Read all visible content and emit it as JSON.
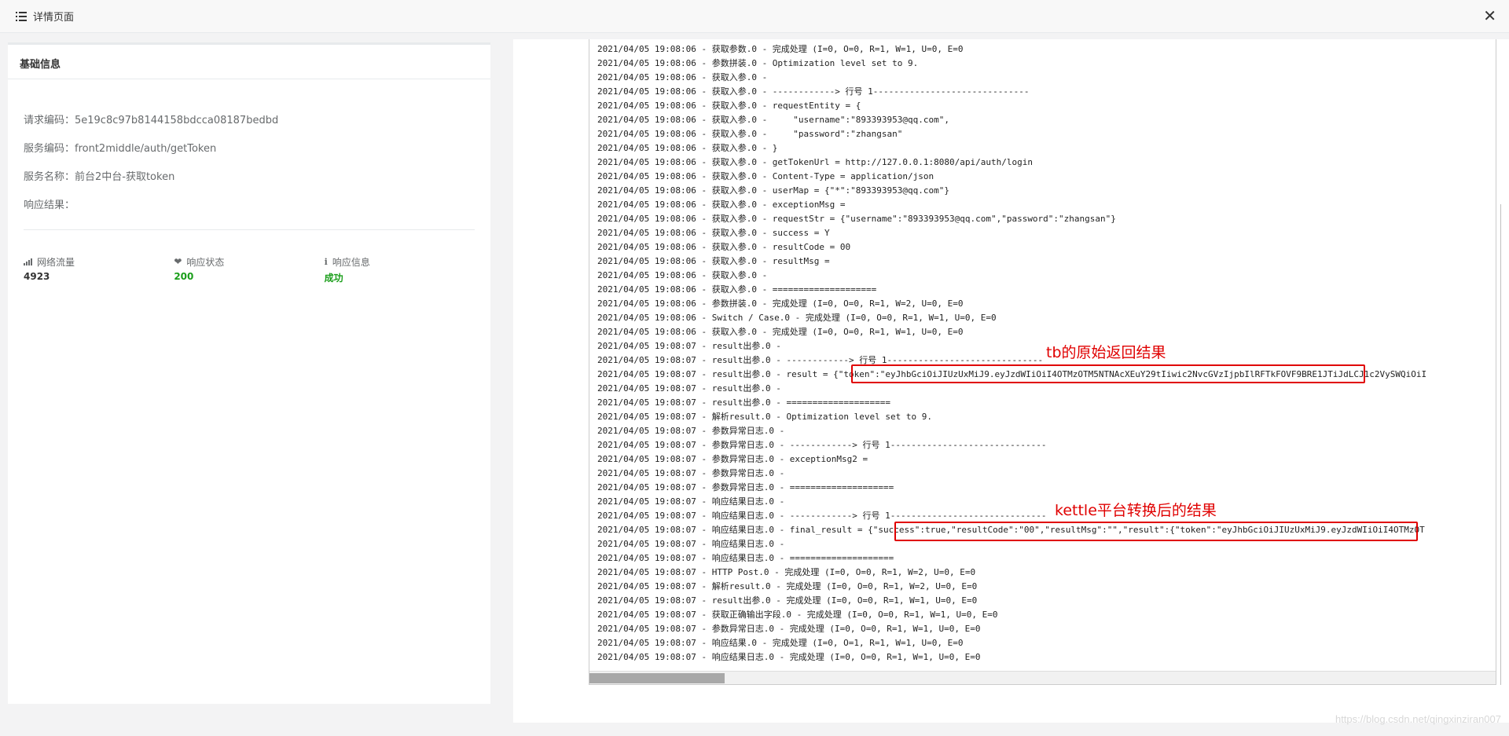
{
  "window": {
    "title": "详情页面",
    "close_symbol": "✕"
  },
  "basic_info": {
    "panel_title": "基础信息",
    "fields": [
      {
        "text": "请求编码：5e19c8c97b8144158bdcca08187bedbd"
      },
      {
        "text": "服务编码：front2middle/auth/getToken"
      },
      {
        "text": "服务名称：前台2中台-获取token"
      },
      {
        "text": "响应结果："
      }
    ],
    "stats": [
      {
        "label": "网络流量",
        "value": "4923",
        "icon": "signal-icon",
        "color": "#333333"
      },
      {
        "label": "响应状态",
        "value": "200",
        "icon": "heartbeat-icon",
        "color": "#1ab394"
      },
      {
        "label": "响应信息",
        "value": "成功",
        "icon": "info-icon",
        "color": "#1ab394"
      }
    ]
  },
  "log_lines": [
    "2021/04/05 19:08:06 - 获取参数.0 - 完成处理 (I=0, O=0, R=1, W=1, U=0, E=0",
    "2021/04/05 19:08:06 - 参数拼装.0 - Optimization level set to 9.",
    "2021/04/05 19:08:06 - 获取入参.0 -",
    "2021/04/05 19:08:06 - 获取入参.0 - ------------> 行号 1------------------------------",
    "2021/04/05 19:08:06 - 获取入参.0 - requestEntity = {",
    "2021/04/05 19:08:06 - 获取入参.0 -     \"username\":\"893393953@qq.com\",",
    "2021/04/05 19:08:06 - 获取入参.0 -     \"password\":\"zhangsan\"",
    "2021/04/05 19:08:06 - 获取入参.0 - }",
    "2021/04/05 19:08:06 - 获取入参.0 - getTokenUrl = http://127.0.0.1:8080/api/auth/login",
    "2021/04/05 19:08:06 - 获取入参.0 - Content-Type = application/json",
    "2021/04/05 19:08:06 - 获取入参.0 - userMap = {\"*\":\"893393953@qq.com\"}",
    "2021/04/05 19:08:06 - 获取入参.0 - exceptionMsg =",
    "2021/04/05 19:08:06 - 获取入参.0 - requestStr = {\"username\":\"893393953@qq.com\",\"password\":\"zhangsan\"}",
    "2021/04/05 19:08:06 - 获取入参.0 - success = Y",
    "2021/04/05 19:08:06 - 获取入参.0 - resultCode = 00",
    "2021/04/05 19:08:06 - 获取入参.0 - resultMsg =",
    "2021/04/05 19:08:06 - 获取入参.0 -",
    "2021/04/05 19:08:06 - 获取入参.0 - ====================",
    "2021/04/05 19:08:06 - 参数拼装.0 - 完成处理 (I=0, O=0, R=1, W=2, U=0, E=0",
    "2021/04/05 19:08:06 - Switch / Case.0 - 完成处理 (I=0, O=0, R=1, W=1, U=0, E=0",
    "2021/04/05 19:08:06 - 获取入参.0 - 完成处理 (I=0, O=0, R=1, W=1, U=0, E=0",
    "2021/04/05 19:08:07 - result出参.0 -",
    "2021/04/05 19:08:07 - result出参.0 - ------------> 行号 1------------------------------",
    "2021/04/05 19:08:07 - result出参.0 - result = {\"token\":\"eyJhbGciOiJIUzUxMiJ9.eyJzdWIiOiI4OTMzOTM5NTNAcXEuY29tIiwic2NvcGVzIjpbIlRFTkFOVF9BRE1JTiJdLCJ1c2VySWQiOiI",
    "2021/04/05 19:08:07 - result出参.0 -",
    "2021/04/05 19:08:07 - result出参.0 - ====================",
    "2021/04/05 19:08:07 - 解析result.0 - Optimization level set to 9.",
    "2021/04/05 19:08:07 - 参数异常日志.0 -",
    "2021/04/05 19:08:07 - 参数异常日志.0 - ------------> 行号 1------------------------------",
    "2021/04/05 19:08:07 - 参数异常日志.0 - exceptionMsg2 =",
    "2021/04/05 19:08:07 - 参数异常日志.0 -",
    "2021/04/05 19:08:07 - 参数异常日志.0 - ====================",
    "2021/04/05 19:08:07 - 响应结果日志.0 -",
    "2021/04/05 19:08:07 - 响应结果日志.0 - ------------> 行号 1------------------------------",
    "2021/04/05 19:08:07 - 响应结果日志.0 - final_result = {\"success\":true,\"resultCode\":\"00\",\"resultMsg\":\"\",\"result\":{\"token\":\"eyJhbGciOiJIUzUxMiJ9.eyJzdWIiOiI4OTMzOT",
    "2021/04/05 19:08:07 - 响应结果日志.0 -",
    "2021/04/05 19:08:07 - 响应结果日志.0 - ====================",
    "2021/04/05 19:08:07 - HTTP Post.0 - 完成处理 (I=0, O=0, R=1, W=2, U=0, E=0",
    "2021/04/05 19:08:07 - 解析result.0 - 完成处理 (I=0, O=0, R=1, W=2, U=0, E=0",
    "2021/04/05 19:08:07 - result出参.0 - 完成处理 (I=0, O=0, R=1, W=1, U=0, E=0",
    "2021/04/05 19:08:07 - 获取正确输出字段.0 - 完成处理 (I=0, O=0, R=1, W=1, U=0, E=0",
    "2021/04/05 19:08:07 - 参数异常日志.0 - 完成处理 (I=0, O=0, R=1, W=1, U=0, E=0",
    "2021/04/05 19:08:07 - 响应结果.0 - 完成处理 (I=0, O=1, R=1, W=1, U=0, E=0",
    "2021/04/05 19:08:07 - 响应结果日志.0 - 完成处理 (I=0, O=0, R=1, W=1, U=0, E=0"
  ],
  "annotations": {
    "tb_result": "tb的原始返回结果",
    "kettle_result": "kettle平台转换后的结果"
  },
  "watermark": "https://blog.csdn.net/qingxinziran007",
  "colors": {
    "annotation": "#e00000",
    "success": "#1ab394"
  }
}
